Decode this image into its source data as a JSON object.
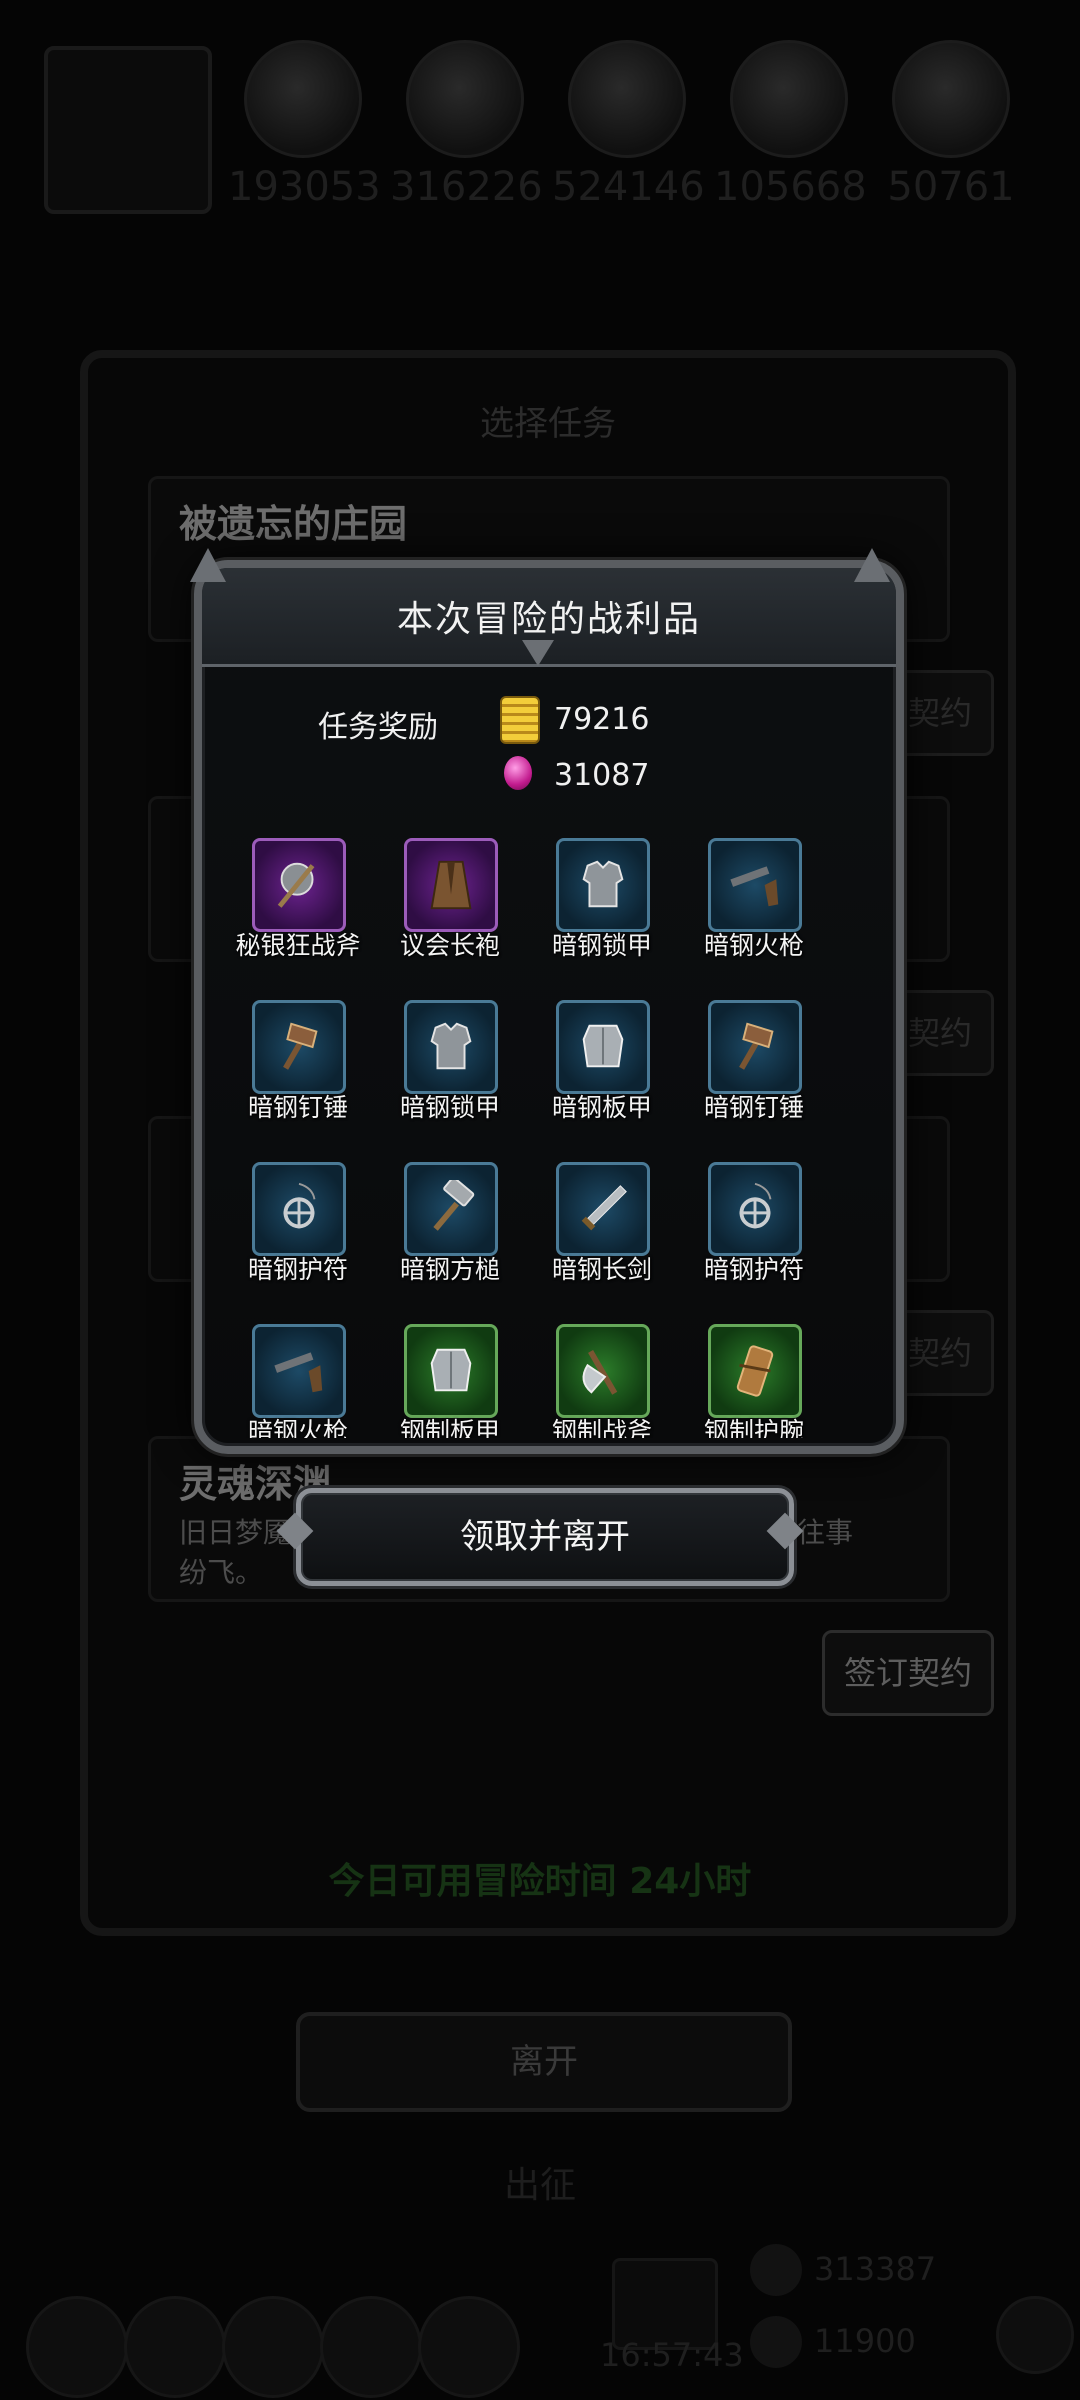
{
  "top_resources": [
    {
      "icon": "wood-resource-icon",
      "value": "193053"
    },
    {
      "icon": "ore-resource-icon",
      "value": "316226"
    },
    {
      "icon": "stone-resource-icon",
      "value": "524146"
    },
    {
      "icon": "mana-resource-icon",
      "value": "105668"
    },
    {
      "icon": "feather-resource-icon",
      "value": "50761"
    }
  ],
  "task_panel": {
    "title": "选择任务",
    "tasks": [
      {
        "name": "被遗忘的庄园",
        "desc": "",
        "button": "签订契约"
      },
      {
        "name": "",
        "desc": "",
        "button": "签订契约"
      },
      {
        "name": "",
        "desc": "",
        "button": "签订契约"
      },
      {
        "name": "灵魂深渊",
        "desc": "旧日梦魇的",
        "desc_tail": "，往事",
        "desc_line2": "纷飞。",
        "button": "签订契约"
      }
    ],
    "time_left": "今日可用冒险时间 24小时",
    "leave_button": "离开"
  },
  "expedition_label": "出征",
  "clock": "16:57:43",
  "bottom_gold": "313387",
  "bottom_blue": "11900",
  "loot_dialog": {
    "title": "本次冒险的战利品",
    "reward_label": "任务奖励",
    "gold": "79216",
    "gems": "31087",
    "items": [
      {
        "name": "秘银狂战斧",
        "rarity": "purple",
        "icon": "axe"
      },
      {
        "name": "议会长袍",
        "rarity": "purple",
        "icon": "robe"
      },
      {
        "name": "暗钢锁甲",
        "rarity": "blue",
        "icon": "armor"
      },
      {
        "name": "暗钢火枪",
        "rarity": "blue",
        "icon": "gun"
      },
      {
        "name": "暗钢钉锤",
        "rarity": "blue",
        "icon": "hammer"
      },
      {
        "name": "暗钢锁甲",
        "rarity": "blue",
        "icon": "armor"
      },
      {
        "name": "暗钢板甲",
        "rarity": "blue",
        "icon": "plate"
      },
      {
        "name": "暗钢钉锤",
        "rarity": "blue",
        "icon": "hammer"
      },
      {
        "name": "暗钢护符",
        "rarity": "blue",
        "icon": "amulet"
      },
      {
        "name": "暗钢方槌",
        "rarity": "blue",
        "icon": "mallet"
      },
      {
        "name": "暗钢长剑",
        "rarity": "blue",
        "icon": "sword"
      },
      {
        "name": "暗钢护符",
        "rarity": "blue",
        "icon": "amulet"
      },
      {
        "name": "暗钢火枪",
        "rarity": "blue",
        "icon": "gun"
      },
      {
        "name": "钢制板甲",
        "rarity": "green",
        "icon": "plate"
      },
      {
        "name": "钢制战斧",
        "rarity": "green",
        "icon": "axe2"
      },
      {
        "name": "钢制护腕",
        "rarity": "green",
        "icon": "bracer"
      }
    ],
    "claim_button": "领取并离开"
  }
}
